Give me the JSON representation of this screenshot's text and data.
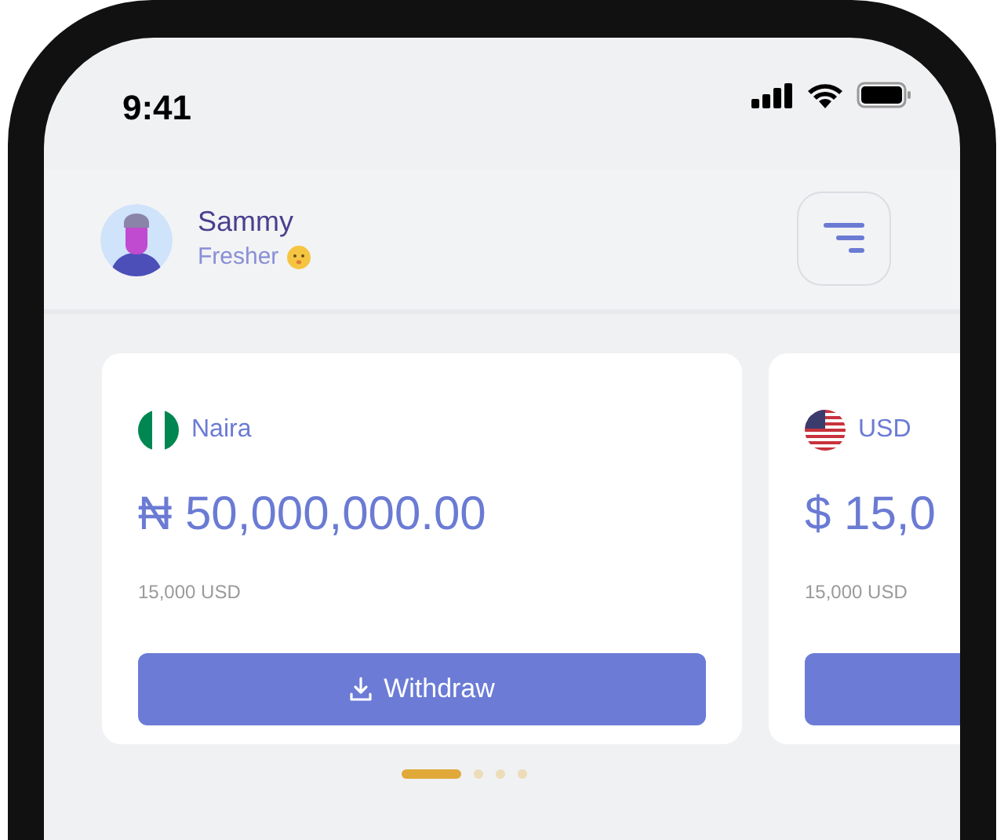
{
  "status_bar": {
    "time": "9:41"
  },
  "profile": {
    "name": "Sammy",
    "level": "Fresher"
  },
  "cards": [
    {
      "kind": "ng",
      "currency": "Naira",
      "amount": "₦ 50,000,000.00",
      "converted": "15,000 USD",
      "button": "Withdraw"
    },
    {
      "kind": "us",
      "currency": "USD",
      "amount": "$ 15,0",
      "converted": "15,000 USD"
    }
  ],
  "pager": [
    {
      "selected": true
    },
    {
      "selected": false
    },
    {
      "selected": false
    },
    {
      "selected": false
    }
  ]
}
